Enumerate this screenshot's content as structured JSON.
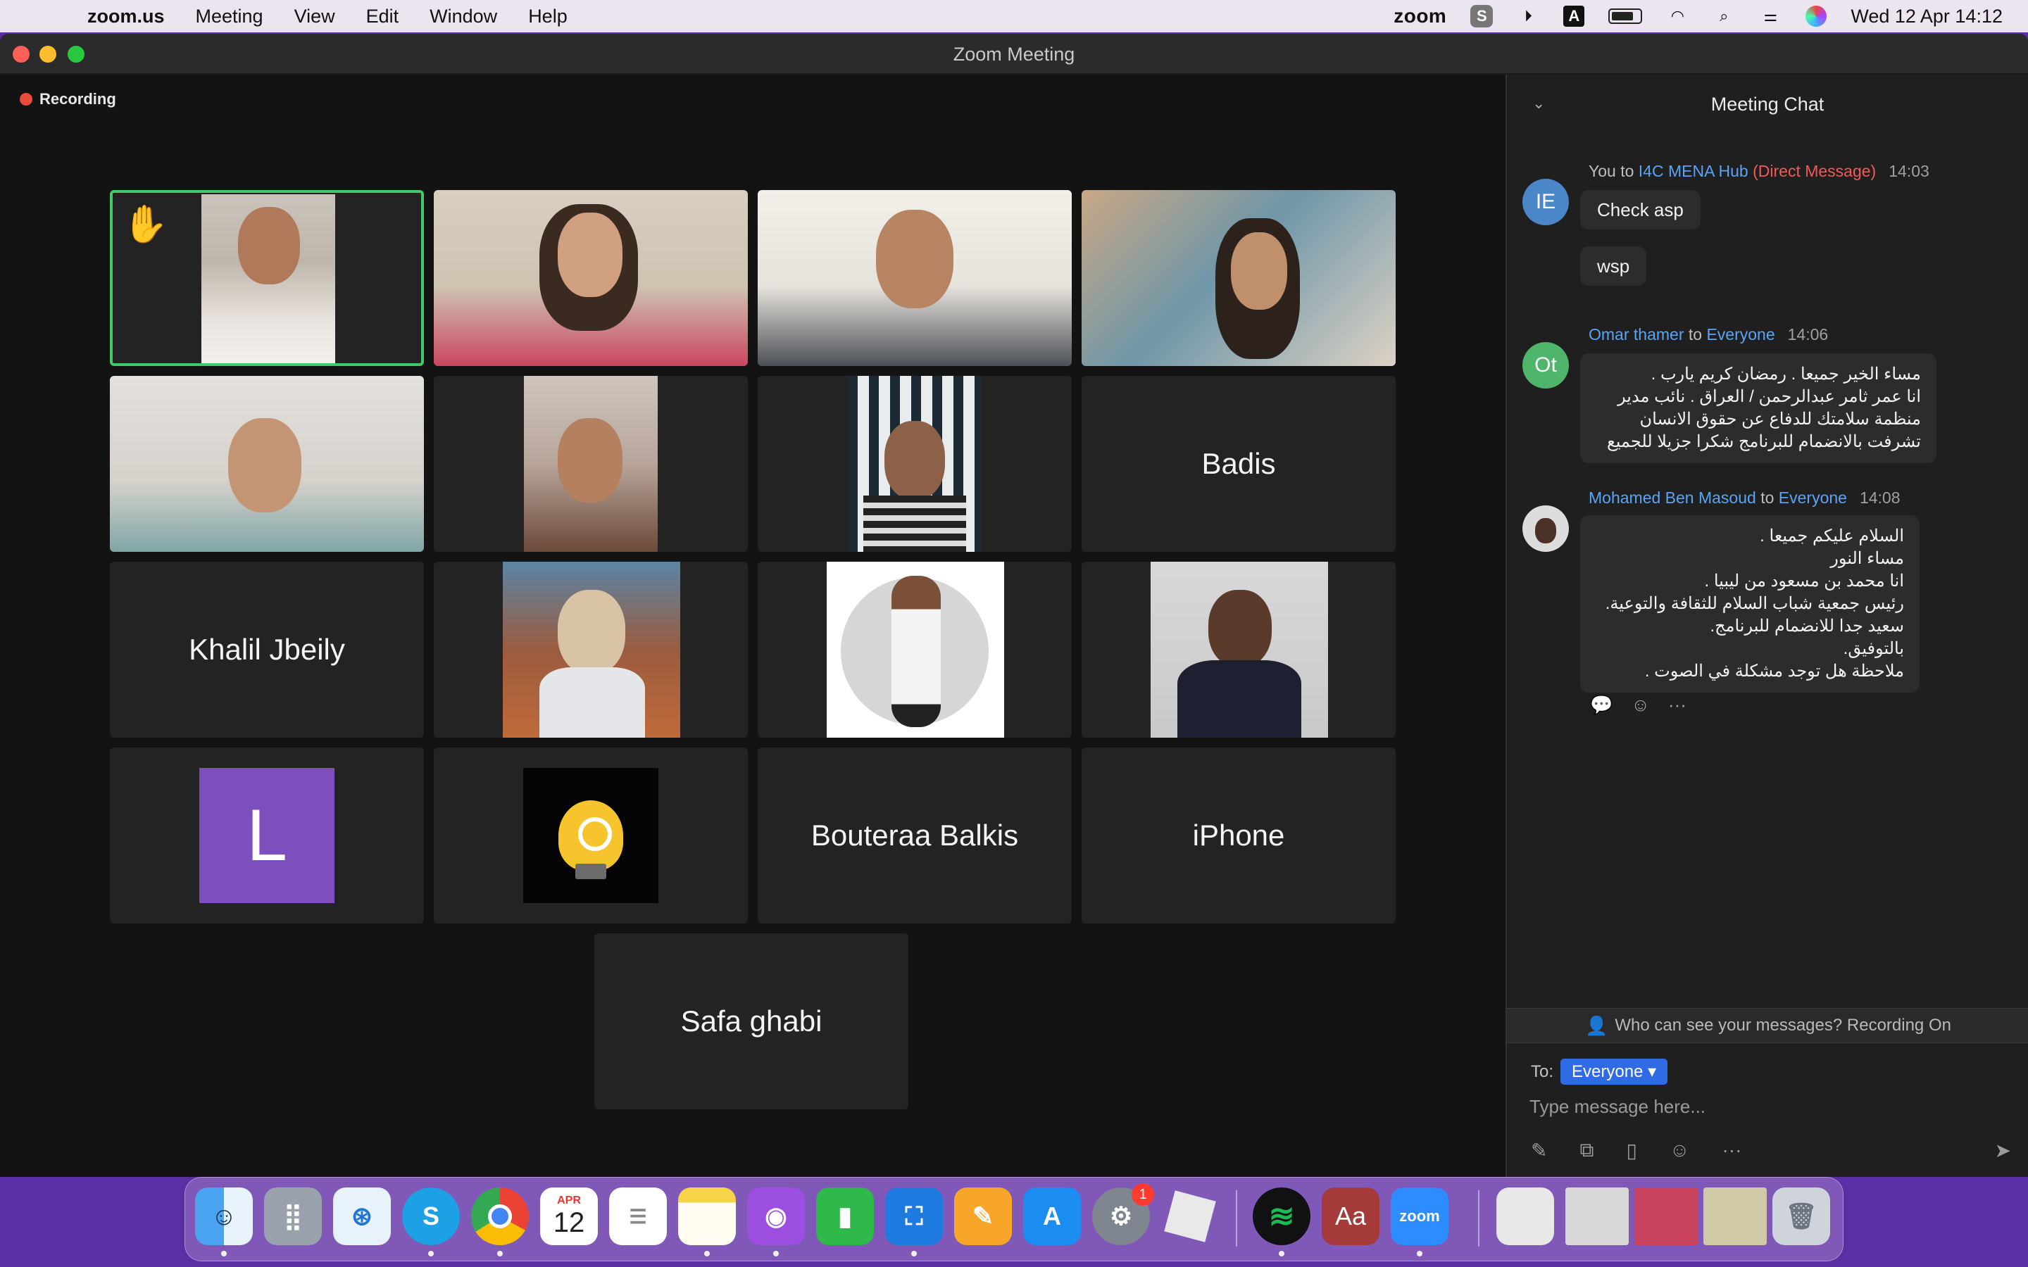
{
  "menubar": {
    "app_name": "zoom.us",
    "items": [
      "Meeting",
      "View",
      "Edit",
      "Window",
      "Help"
    ],
    "zoom_status": "zoom",
    "datetime": "Wed 12 Apr  14:12"
  },
  "window": {
    "title": "Zoom Meeting",
    "recording_label": "Recording"
  },
  "participants": {
    "badis": "Badis",
    "khalil": "Khalil Jbeily",
    "letter_avatar": "L",
    "bouteraa": "Bouteraa Balkis",
    "iphone": "iPhone",
    "safa": "Safa ghabi",
    "raised_hand": "✋"
  },
  "chat": {
    "title": "Meeting Chat",
    "messages": [
      {
        "initials": "IE",
        "prefix": "You to ",
        "recipient": "I4C MENA Hub",
        "dm": " (Direct Message)",
        "time": "14:03",
        "bubbles": [
          "Check asp",
          "wsp"
        ]
      },
      {
        "initials": "Ot",
        "sender": "Omar thamer",
        "to": " to ",
        "recipient": "Everyone",
        "time": "14:06",
        "text": "مساء الخير جميعا . رمضان كريم يارب .\nانا عمر ثامر عبدالرحمن / العراق . نائب مدير\nمنظمة سلامتك للدفاع عن حقوق الانسان\nتشرفت بالانضمام للبرنامج شكرا جزيلا للجميع"
      },
      {
        "sender": "Mohamed Ben Masoud",
        "to": " to ",
        "recipient": "Everyone",
        "time": "14:08",
        "text": "السلام عليكم جميعا .\nمساء النور\nانا محمد بن مسعود  من ليبيا .\nرئيس جمعية شباب السلام للثقافة والتوعية.\nسعيد جدا للانضمام للبرنامج.\nبالتوفيق.\nملاحظة هل توجد مشكلة في الصوت ."
      }
    ],
    "privacy_note": "Who can see your messages? Recording On",
    "to_label": "To:",
    "to_value": "Everyone ▾",
    "input_placeholder": "Type message here...",
    "more": "···"
  },
  "dock": {
    "calendar_month": "APR",
    "calendar_day": "12",
    "settings_badge": "1",
    "dictionary_label": "Aa",
    "zoom_label": "zoom"
  },
  "colors": {
    "active_speaker": "#43c96b",
    "link_blue": "#5aa4f6",
    "dm_red": "#f05a5a",
    "to_pill": "#2e6be4"
  }
}
